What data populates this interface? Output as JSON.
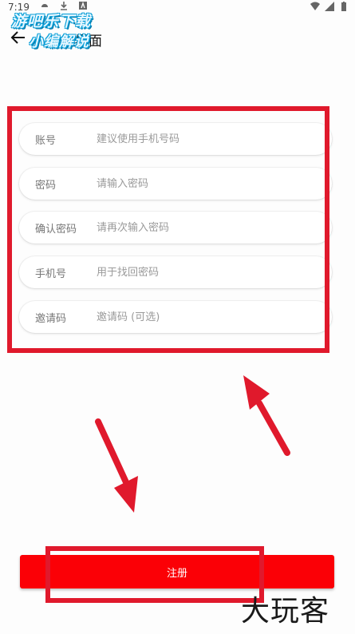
{
  "status_bar": {
    "time": "7:19"
  },
  "watermark_top": {
    "line1": "游吧乐下载",
    "line2": "小编解说"
  },
  "header": {
    "title": "注册界面"
  },
  "form": {
    "rows": [
      {
        "label": "账号",
        "placeholder": "建议使用手机号码"
      },
      {
        "label": "密码",
        "placeholder": "请输入密码"
      },
      {
        "label": "确认密码",
        "placeholder": "请再次输入密码"
      },
      {
        "label": "手机号",
        "placeholder": "用于找回密码"
      },
      {
        "label": "邀请码",
        "placeholder": "邀请码 (可选)"
      }
    ]
  },
  "register_button": {
    "label": "注册"
  },
  "watermark_bottom": {
    "text": "大玩客"
  },
  "colors": {
    "accent": "#fb0006",
    "annotation": "#e0192c"
  }
}
